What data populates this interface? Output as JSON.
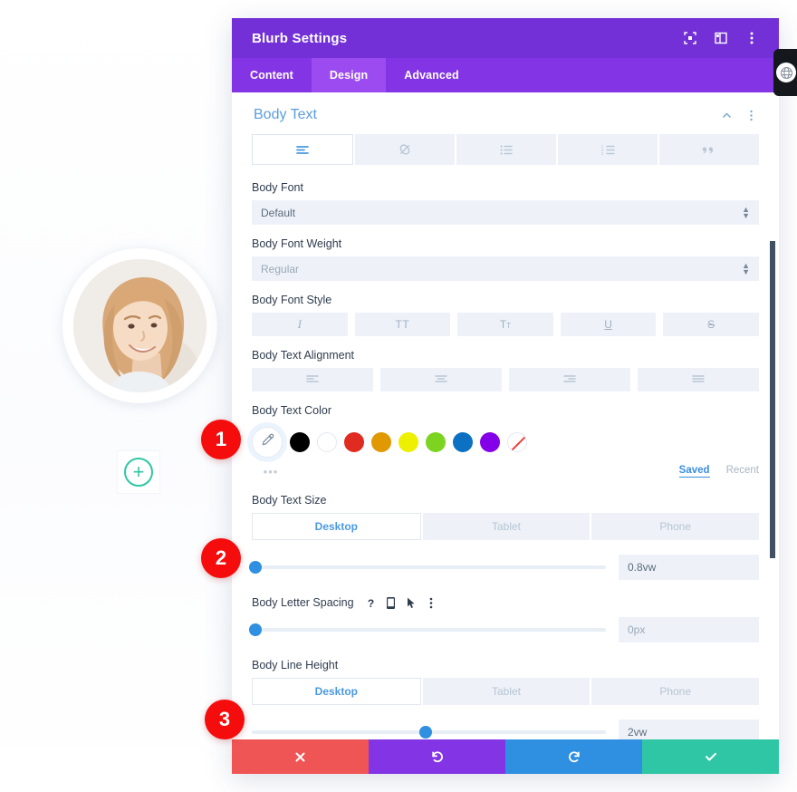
{
  "window": {
    "title": "Blurb Settings",
    "header_icons": [
      {
        "name": "fullscreen-icon",
        "label": "Fullscreen"
      },
      {
        "name": "layout-split-icon",
        "label": "Change layout"
      },
      {
        "name": "more-vertical-icon",
        "label": "More options"
      }
    ],
    "tabs": [
      {
        "label": "Content",
        "active": false
      },
      {
        "label": "Design",
        "active": true
      },
      {
        "label": "Advanced",
        "active": false
      }
    ]
  },
  "section": {
    "title": "Body Text",
    "collapse_icon": "chevron-up-icon",
    "menu_icon": "more-vertical-icon",
    "type_tabs": [
      {
        "name": "paragraph-icon",
        "active": true
      },
      {
        "name": "link-icon",
        "active": false
      },
      {
        "name": "unordered-list-icon",
        "active": false
      },
      {
        "name": "ordered-list-icon",
        "active": false
      },
      {
        "name": "blockquote-icon",
        "active": false
      }
    ]
  },
  "fields": {
    "body_font": {
      "label": "Body Font",
      "value": "Default",
      "options": [
        "Default"
      ]
    },
    "body_font_weight": {
      "label": "Body Font Weight",
      "value": "Regular",
      "options": [
        "Regular"
      ]
    },
    "body_font_style": {
      "label": "Body Font Style",
      "buttons": [
        {
          "name": "italic-icon",
          "glyph": "I"
        },
        {
          "name": "uppercase-icon",
          "glyph": "TT"
        },
        {
          "name": "smallcaps-icon",
          "glyph": "Tт"
        },
        {
          "name": "underline-icon",
          "glyph": "U"
        },
        {
          "name": "strikethrough-icon",
          "glyph": "S"
        }
      ]
    },
    "body_text_alignment": {
      "label": "Body Text Alignment",
      "buttons": [
        {
          "name": "align-left-icon"
        },
        {
          "name": "align-center-icon"
        },
        {
          "name": "align-right-icon"
        },
        {
          "name": "align-justify-icon"
        }
      ]
    },
    "body_text_color": {
      "label": "Body Text Color",
      "eyedropper_icon": "eyedropper-icon",
      "more_dots": "•••",
      "swatches": [
        {
          "name": "swatch-black",
          "hex": "#000000"
        },
        {
          "name": "swatch-white",
          "hex": "#ffffff"
        },
        {
          "name": "swatch-red",
          "hex": "#e02b20"
        },
        {
          "name": "swatch-orange",
          "hex": "#e09900"
        },
        {
          "name": "swatch-yellow",
          "hex": "#edf000"
        },
        {
          "name": "swatch-green",
          "hex": "#7cd420"
        },
        {
          "name": "swatch-blue",
          "hex": "#0c71c3"
        },
        {
          "name": "swatch-purple",
          "hex": "#8300e9"
        },
        {
          "name": "swatch-none",
          "hex": "transparent"
        }
      ],
      "saved_label": "Saved",
      "recent_label": "Recent"
    },
    "body_text_size": {
      "label": "Body Text Size",
      "devices": [
        {
          "label": "Desktop",
          "active": true
        },
        {
          "label": "Tablet",
          "active": false
        },
        {
          "label": "Phone",
          "active": false
        }
      ],
      "value": "0.8vw",
      "slider_percent": 1
    },
    "body_letter_spacing": {
      "label": "Body Letter Spacing",
      "icons": [
        {
          "name": "help-icon",
          "glyph": "?"
        },
        {
          "name": "responsive-device-icon"
        },
        {
          "name": "hover-cursor-icon"
        },
        {
          "name": "more-vertical-icon"
        }
      ],
      "value": "0px",
      "slider_percent": 1
    },
    "body_line_height": {
      "label": "Body Line Height",
      "devices": [
        {
          "label": "Desktop",
          "active": true
        },
        {
          "label": "Tablet",
          "active": false
        },
        {
          "label": "Phone",
          "active": false
        }
      ],
      "value": "2vw",
      "slider_percent": 49
    }
  },
  "footer": {
    "buttons": [
      {
        "name": "cancel-button",
        "icon": "close-icon",
        "color": "#f05555"
      },
      {
        "name": "undo-button",
        "icon": "undo-icon",
        "color": "#8334e5"
      },
      {
        "name": "redo-button",
        "icon": "redo-icon",
        "color": "#2f8fe0"
      },
      {
        "name": "save-button",
        "icon": "check-icon",
        "color": "#2fc6a5"
      }
    ]
  },
  "annotations": {
    "badge_1": "1",
    "badge_2": "2",
    "badge_3": "3"
  },
  "preview": {
    "avatar_name": "person-portrait-avatar",
    "add_button_glyph": "+"
  },
  "colors": {
    "header_purple": "#7230d6",
    "tabbar_purple": "#8334e5",
    "tab_active_purple": "#9b4bf0",
    "accent_blue": "#4a9ae0",
    "badge_red": "#f50d0d",
    "teal": "#2fc6a5"
  }
}
